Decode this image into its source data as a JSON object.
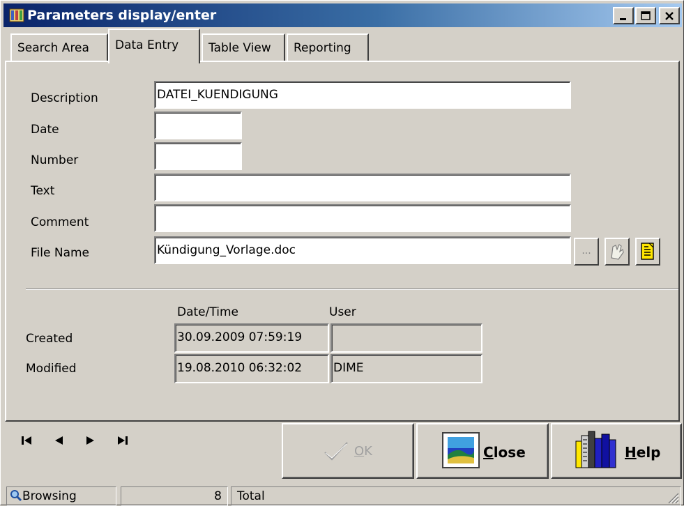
{
  "window": {
    "title": "Parameters display/enter",
    "icon": "app-icon",
    "controls": [
      "minimize-icon",
      "maximize-icon",
      "close-icon"
    ]
  },
  "tabs": [
    {
      "label": "Search Area",
      "active": false
    },
    {
      "label": "Data Entry",
      "active": true
    },
    {
      "label": "Table View",
      "active": false
    },
    {
      "label": "Reporting",
      "active": false
    }
  ],
  "form": {
    "description": {
      "label": "Description",
      "value": "DATEI_KUENDIGUNG"
    },
    "date": {
      "label": "Date",
      "value": ""
    },
    "number": {
      "label": "Number",
      "value": ""
    },
    "text": {
      "label": "Text",
      "value": ""
    },
    "comment": {
      "label": "Comment",
      "value": ""
    },
    "file_name": {
      "label": "File Name",
      "value": "Kündigung_Vorlage.doc",
      "browse_label": "...",
      "icons": [
        "open-file-icon",
        "document-icon"
      ]
    }
  },
  "audit": {
    "col_datetime": "Date/Time",
    "col_user": "User",
    "created": {
      "label": "Created",
      "datetime": "30.09.2009 07:59:19",
      "user": ""
    },
    "modified": {
      "label": "Modified",
      "datetime": "19.08.2010 06:32:02",
      "user": "DIME"
    }
  },
  "buttons": {
    "ok": {
      "prefix": "",
      "accel": "O",
      "rest": "K",
      "enabled": false
    },
    "close": {
      "accel": "C",
      "rest": "lose"
    },
    "help": {
      "accel": "H",
      "rest": "elp"
    }
  },
  "navigation": [
    "first-record-icon",
    "previous-record-icon",
    "next-record-icon",
    "last-record-icon"
  ],
  "statusbar": {
    "mode": "Browsing",
    "count": "8",
    "total_label": "Total"
  }
}
